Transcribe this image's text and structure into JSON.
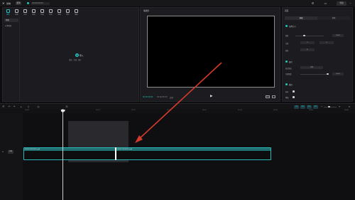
{
  "app": {
    "logo": "✕",
    "brand": "剪映",
    "menu_label": "菜单",
    "project_title": "0000000000",
    "export_label": "导出"
  },
  "media_panel": {
    "tools": [
      {
        "label": "媒体",
        "active": true
      },
      {
        "label": "音频",
        "active": false
      },
      {
        "label": "文本",
        "active": false
      },
      {
        "label": "贴纸",
        "active": false
      },
      {
        "label": "特效",
        "active": false
      },
      {
        "label": "转场",
        "active": false
      },
      {
        "label": "滤镜",
        "active": false
      },
      {
        "label": "调节",
        "active": false
      },
      {
        "label": "模板",
        "active": false
      }
    ],
    "sidebar": {
      "local": "本地",
      "import": "▸ 素材库"
    },
    "import_label": "导入",
    "import_hint": "视频、音频、图片"
  },
  "player": {
    "title": "播放器",
    "time_current": "00:00:00:00",
    "time_total": "00:00:05:00",
    "mode": "比例",
    "ratio_label": "比例"
  },
  "properties": {
    "title": "画面",
    "tabs": [
      "基础",
      "抠像"
    ],
    "sections": {
      "position": {
        "label": "位置大小",
        "scale_label": "缩放",
        "scale_value": "100%",
        "pos_label": "位置",
        "pos_x": "0",
        "pos_y": "0",
        "rotate_label": "旋转",
        "rotate_value": "0°"
      },
      "blend": {
        "label": "混合",
        "mode_label": "混合模式",
        "mode_value": "正常",
        "opacity_label": "不透明度",
        "opacity_value": "100%"
      },
      "stabilize": {
        "label": "防抖",
        "row1_label": "防抖",
        "row2_label": "降噪"
      }
    }
  },
  "timeline": {
    "ticks": [
      "00:00",
      "00:05",
      "00:10",
      "00:15",
      "00:20",
      "00:25",
      "00:30",
      "00:35",
      "00:40",
      "00:45"
    ],
    "track_cover": "封面",
    "clip_label_left": "00000 0000000.mp4",
    "clip_label_right": "00000 0000000.mp4",
    "buttons": [
      "主轨",
      "吸附",
      "联动",
      "预览"
    ]
  }
}
